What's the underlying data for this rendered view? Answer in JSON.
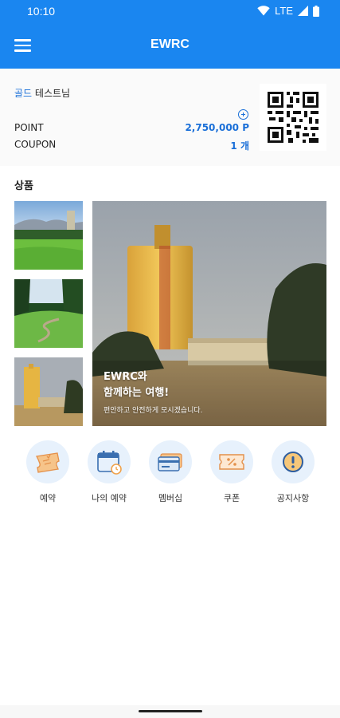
{
  "status_bar": {
    "time": "10:10",
    "network": "LTE"
  },
  "app_bar": {
    "title": "EWRC"
  },
  "member": {
    "grade": "골드",
    "name": "테스트님",
    "point_label": "POINT",
    "point_value": "2,750,000 P",
    "coupon_label": "COUPON",
    "coupon_value": "1 개"
  },
  "products": {
    "title": "상품",
    "hero_line1": "EWRC와",
    "hero_line2": "함께하는 여행!",
    "hero_sub": "편안하고 안전하게 모시겠습니다."
  },
  "quick_menu": [
    {
      "label": "예약",
      "icon": "ticket-icon"
    },
    {
      "label": "나의 예약",
      "icon": "calendar-icon"
    },
    {
      "label": "멤버십",
      "icon": "membership-card-icon"
    },
    {
      "label": "쿠폰",
      "icon": "coupon-icon"
    },
    {
      "label": "공지사항",
      "icon": "notice-icon"
    }
  ],
  "colors": {
    "primary": "#1a86f0",
    "accent_text": "#1a6fd8",
    "icon_bg": "#e7f1fc"
  }
}
